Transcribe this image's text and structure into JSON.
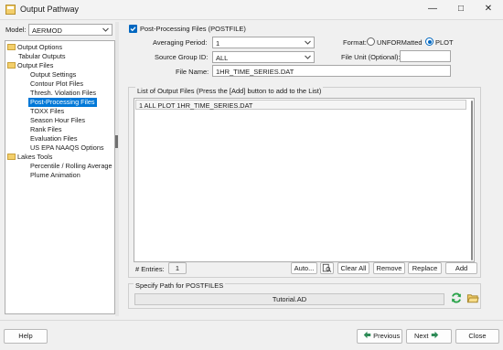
{
  "window": {
    "title": "Output Pathway",
    "controls": [
      "minimize",
      "maximize",
      "close"
    ]
  },
  "left_panel": {
    "model_label": "Model:",
    "model_value": "AERMOD",
    "tree": [
      {
        "label": "Output Options",
        "type": "folder"
      },
      {
        "label": "Tabular Outputs",
        "type": "item"
      },
      {
        "label": "Output Files",
        "type": "folder"
      },
      {
        "label": "Output Settings",
        "type": "item"
      },
      {
        "label": "Contour Plot Files",
        "type": "item"
      },
      {
        "label": "Thresh. Violation Files",
        "type": "item"
      },
      {
        "label": "Post-Processing Files",
        "type": "item",
        "selected": true
      },
      {
        "label": "TOXX Files",
        "type": "item"
      },
      {
        "label": "Season Hour Files",
        "type": "item"
      },
      {
        "label": "Rank Files",
        "type": "item"
      },
      {
        "label": "Evaluation Files",
        "type": "item"
      },
      {
        "label": "US EPA NAAQS Options",
        "type": "item"
      },
      {
        "label": "Lakes Tools",
        "type": "folder"
      },
      {
        "label": "Percentile / Rolling Average",
        "type": "item"
      },
      {
        "label": "Plume Animation",
        "type": "item"
      }
    ]
  },
  "form": {
    "enable_label": "Post-Processing Files (POSTFILE)",
    "enable_checked": true,
    "averaging_label": "Averaging Period:",
    "averaging_value": "1",
    "source_group_label": "Source Group ID:",
    "source_group_value": "ALL",
    "file_name_label": "File Name:",
    "file_name_value": "1HR_TIME_SERIES.DAT",
    "format_label": "Format:",
    "format_options": [
      "UNFORMatted",
      "PLOT"
    ],
    "format_selected": "PLOT",
    "file_unit_label": "File Unit (Optional):",
    "file_unit_value": ""
  },
  "output_list": {
    "header": "List of Output Files (Press the [Add] button to add to the List)",
    "rows": [
      "1 ALL PLOT 1HR_TIME_SERIES.DAT"
    ],
    "entries_label": "# Entries:",
    "entries_count": "1"
  },
  "buttons": {
    "auto": "Auto...",
    "clear_all": "Clear All",
    "remove": "Remove",
    "replace": "Replace",
    "add": "Add"
  },
  "path": {
    "label": "Specify Path for POSTFILES",
    "value": "Tutorial.AD"
  },
  "footer": {
    "help": "Help",
    "previous": "Previous",
    "next": "Next",
    "close": "Close"
  },
  "colors": {
    "accent": "#0078d7",
    "nav_arrow": "#2e8b57",
    "refresh": "#2aa34a",
    "folder": "#f3cf6b"
  }
}
